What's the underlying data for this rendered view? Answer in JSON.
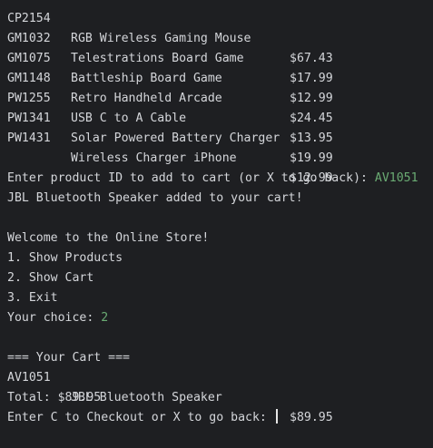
{
  "products": [
    {
      "id": "CP2154",
      "name": "RGB Wireless Gaming Mouse",
      "price": "$67.43"
    },
    {
      "id": "GM1032",
      "name": "Telestrations Board Game",
      "price": "$17.99"
    },
    {
      "id": "GM1075",
      "name": "Battleship Board Game",
      "price": "$12.99"
    },
    {
      "id": "GM1148",
      "name": "Retro Handheld Arcade",
      "price": "$24.45"
    },
    {
      "id": "PW1255",
      "name": "USB C to A Cable",
      "price": "$13.95"
    },
    {
      "id": "PW1341",
      "name": "Solar Powered Battery Charger",
      "price": "$19.99"
    },
    {
      "id": "PW1431",
      "name": "Wireless Charger iPhone",
      "price": "$12.99"
    }
  ],
  "add_prompt": {
    "text": "Enter product ID to add to cart (or X to go back): ",
    "input": "AV1051"
  },
  "added_message": "JBL Bluetooth Speaker added to your cart!",
  "menu": {
    "welcome": "Welcome to the Online Store!",
    "options": [
      "1. Show Products",
      "2. Show Cart",
      "3. Exit"
    ],
    "choice_prompt": "Your choice: ",
    "choice_input": "2"
  },
  "cart": {
    "header": "=== Your Cart ===",
    "items": [
      {
        "id": "AV1051",
        "name": "JBL Bluetooth Speaker",
        "price": "$89.95"
      }
    ],
    "total": "Total: $89.95"
  },
  "checkout_prompt": "Enter C to Checkout or X to go back: "
}
